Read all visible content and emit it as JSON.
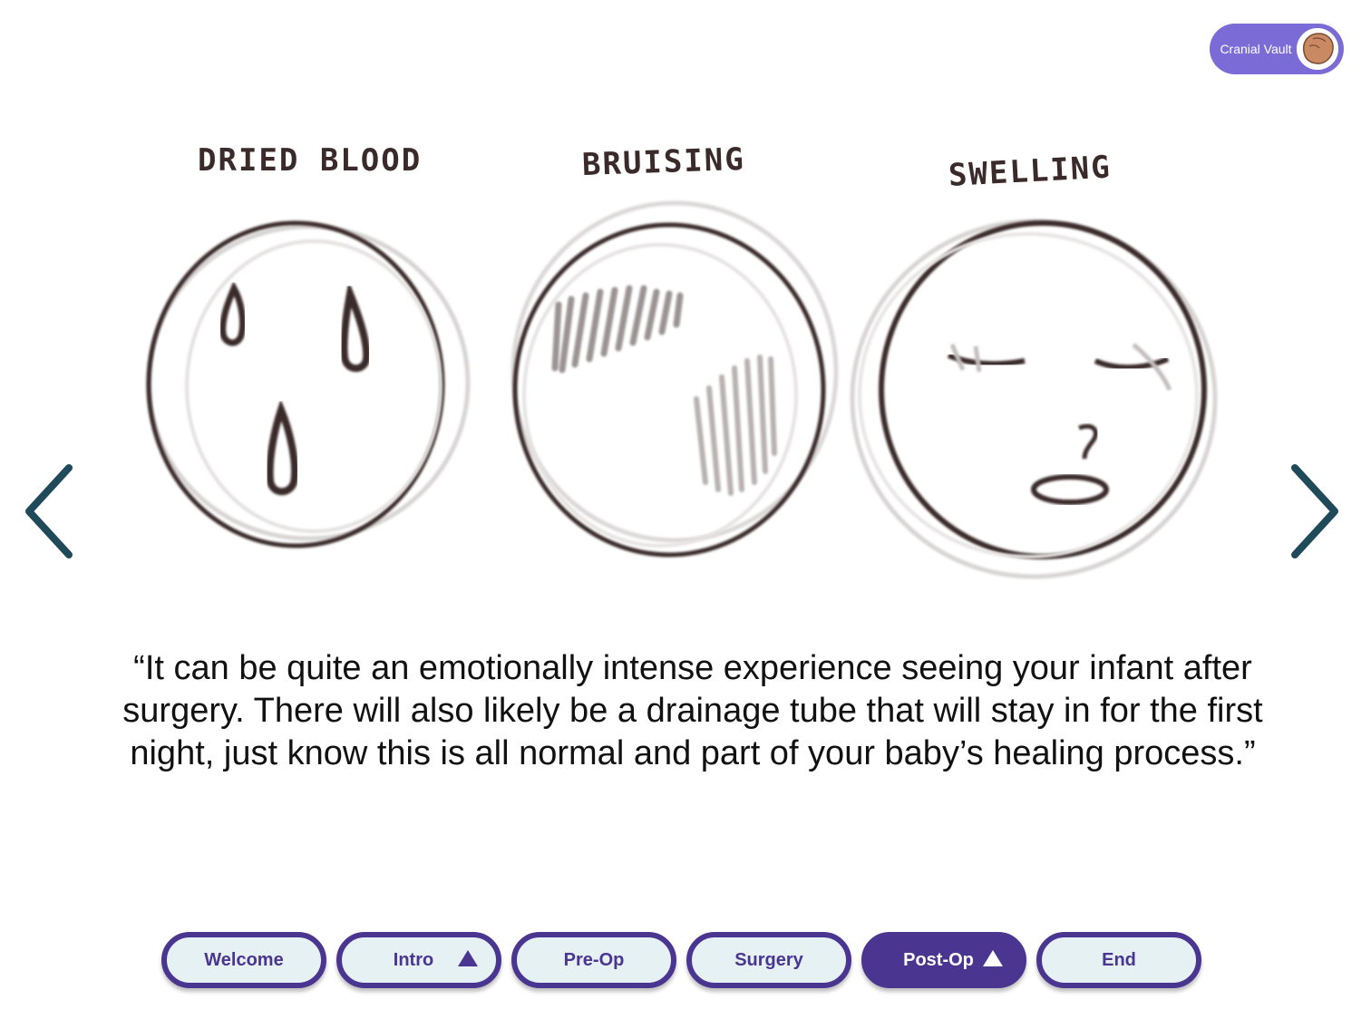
{
  "badge": {
    "label": "Cranial Vault",
    "icon": "baby-head-avatar-icon"
  },
  "illustration": {
    "labels": [
      "DRIED BLOOD",
      "BRUISING",
      "SWELLING"
    ]
  },
  "quote": {
    "text": "“It can be quite an emotionally intense experience seeing your infant after surgery. There will also likely be a drainage tube that will stay in for the first night, just know this is all normal and part of your baby’s healing process.”"
  },
  "navigation": {
    "prev_icon": "chevron-left-icon",
    "next_icon": "chevron-right-icon",
    "tabs": [
      {
        "label": "Welcome",
        "active": false,
        "has_submenu": false
      },
      {
        "label": "Intro",
        "active": false,
        "has_submenu": true
      },
      {
        "label": "Pre-Op",
        "active": false,
        "has_submenu": false
      },
      {
        "label": "Surgery",
        "active": false,
        "has_submenu": false
      },
      {
        "label": "Post-Op",
        "active": true,
        "has_submenu": true
      },
      {
        "label": "End",
        "active": false,
        "has_submenu": false
      }
    ]
  },
  "colors": {
    "primary_purple": "#4a3591",
    "badge_purple": "#7b6bd6",
    "button_fill": "#e6f1f3",
    "arrow_color": "#1f4a5a",
    "sketch_ink": "#3a2a2a"
  }
}
